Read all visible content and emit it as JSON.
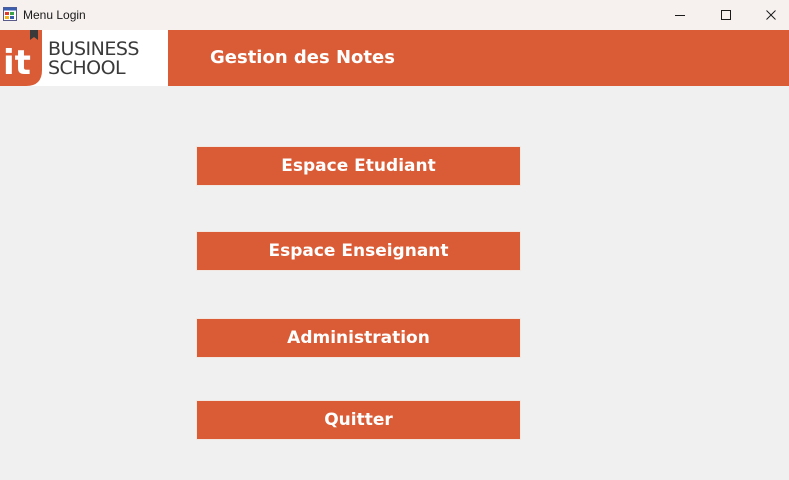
{
  "window": {
    "title": "Menu Login",
    "app_icon": "windows-form-icon",
    "controls": {
      "minimize_icon": "minimize-icon",
      "maximize_icon": "maximize-icon",
      "close_icon": "close-icon"
    }
  },
  "header": {
    "logo": {
      "mark": "it",
      "line1": "BUSINESS",
      "line2": "SCHOOL"
    },
    "title": "Gestion des Notes",
    "background_color": "#d95c36"
  },
  "menu": {
    "buttons": [
      {
        "label": "Espace Etudiant"
      },
      {
        "label": "Espace Enseignant"
      },
      {
        "label": "Administration"
      },
      {
        "label": "Quitter"
      }
    ],
    "button_color": "#d95c36",
    "text_color": "#ffffff"
  }
}
